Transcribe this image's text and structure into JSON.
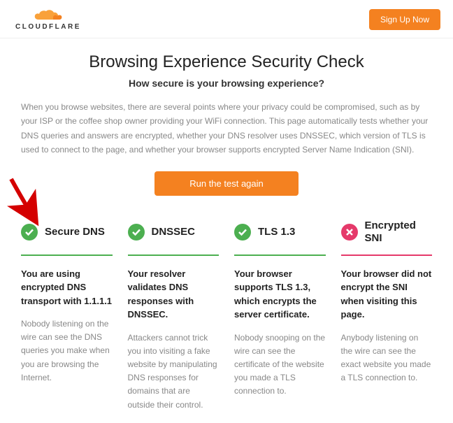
{
  "header": {
    "brand": "CLOUDFLARE",
    "signup_label": "Sign Up Now"
  },
  "page": {
    "title": "Browsing Experience Security Check",
    "subtitle": "How secure is your browsing experience?",
    "intro": "When you browse websites, there are several points where your privacy could be compromised, such as by your ISP or the coffee shop owner providing your WiFi connection. This page automatically tests whether your DNS queries and answers are encrypted, whether your DNS resolver uses DNSSEC, which version of TLS is used to connect to the page, and whether your browser supports encrypted Server Name Indication (SNI).",
    "run_button": "Run the test again"
  },
  "cards": [
    {
      "status": "pass",
      "title": "Secure DNS",
      "strong": "You are using encrypted DNS transport with 1.1.1.1",
      "desc": "Nobody listening on the wire can see the DNS queries you make when you are browsing the Internet."
    },
    {
      "status": "pass",
      "title": "DNSSEC",
      "strong": "Your resolver validates DNS responses with DNSSEC.",
      "desc": "Attackers cannot trick you into visiting a fake website by manipulating DNS responses for domains that are outside their control."
    },
    {
      "status": "pass",
      "title": "TLS 1.3",
      "strong": "Your browser supports TLS 1.3, which encrypts the server certificate.",
      "desc": "Nobody snooping on the wire can see the certificate of the website you made a TLS connection to."
    },
    {
      "status": "fail",
      "title": "Encrypted SNI",
      "strong": "Your browser did not encrypt the SNI when visiting this page.",
      "desc": "Anybody listening on the wire can see the exact website you made a TLS connection to."
    }
  ],
  "colors": {
    "accent": "#f48120",
    "pass": "#4caf50",
    "fail": "#e5396a"
  },
  "annotations": {
    "red_arrow_target": "secure-dns-card"
  }
}
